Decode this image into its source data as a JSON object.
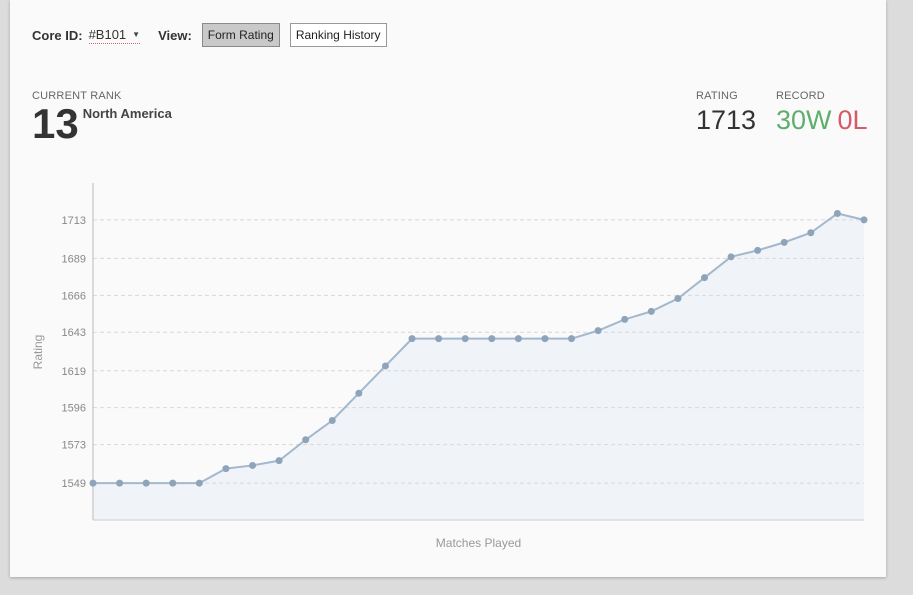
{
  "toolbar": {
    "core_id_label": "Core ID:",
    "core_id_value": "#B101",
    "view_label": "View:",
    "buttons": [
      "Form Rating",
      "Ranking History"
    ],
    "active_button": "Form Rating"
  },
  "summary": {
    "rank_label": "CURRENT RANK",
    "rank_value": "13",
    "region": "North America",
    "rating_label": "RATING",
    "rating_value": "1713",
    "record_label": "RECORD",
    "wins": "30W",
    "losses": "0L"
  },
  "colors": {
    "line": "#a4b8cd",
    "point": "#8ea4bb",
    "area": "#f0f4f8",
    "wins": "#5fae6e",
    "losses": "#d65b68"
  },
  "chart_data": {
    "type": "area",
    "xlabel": "Matches Played",
    "ylabel": "Rating",
    "yticks": [
      1549,
      1573,
      1596,
      1619,
      1643,
      1666,
      1689,
      1713
    ],
    "ylim": [
      1526,
      1736
    ],
    "grid": true,
    "series": [
      {
        "values": [
          1549,
          1549,
          1549,
          1549,
          1549,
          1558,
          1560,
          1563,
          1576,
          1588,
          1605,
          1622,
          1639,
          1639,
          1639,
          1639,
          1639,
          1639,
          1639,
          1644,
          1651,
          1656,
          1664,
          1677,
          1690,
          1694,
          1699,
          1705,
          1717,
          1713
        ]
      }
    ]
  }
}
